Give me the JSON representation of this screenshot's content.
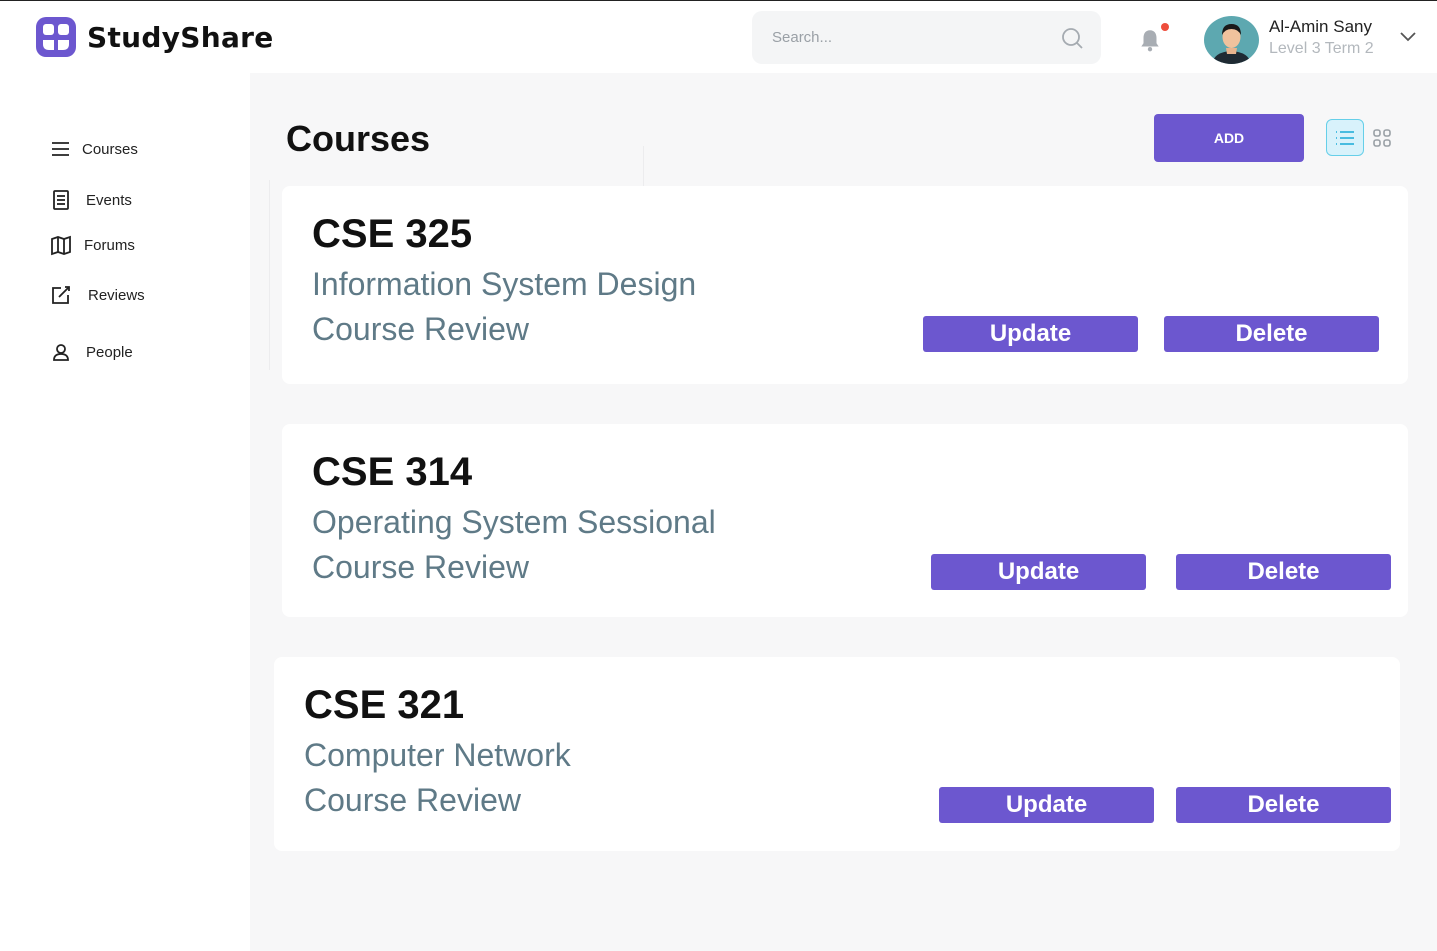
{
  "app": {
    "name": "StudyShare",
    "brand_color": "#6c57cf"
  },
  "search": {
    "placeholder": "Search..."
  },
  "user": {
    "name": "Al-Amin Sany",
    "level": "Level 3 Term 2",
    "has_notification": true
  },
  "sidebar": {
    "items": [
      {
        "label": "Courses",
        "icon": "menu-icon"
      },
      {
        "label": "Events",
        "icon": "document-icon"
      },
      {
        "label": "Forums",
        "icon": "map-icon"
      },
      {
        "label": "Reviews",
        "icon": "edit-icon"
      },
      {
        "label": "People",
        "icon": "person-icon"
      }
    ]
  },
  "main": {
    "title": "Courses",
    "add_label": "ADD",
    "view_mode": "list",
    "courses": [
      {
        "code": "CSE 325",
        "name": "Information System Design",
        "type": "Course Review",
        "update_label": "Update",
        "delete_label": "Delete"
      },
      {
        "code": "CSE 314",
        "name": "Operating System Sessional",
        "type": "Course Review",
        "update_label": "Update",
        "delete_label": "Delete"
      },
      {
        "code": "CSE 321",
        "name": "Computer Network",
        "type": "Course Review",
        "update_label": "Update",
        "delete_label": "Delete"
      }
    ]
  }
}
